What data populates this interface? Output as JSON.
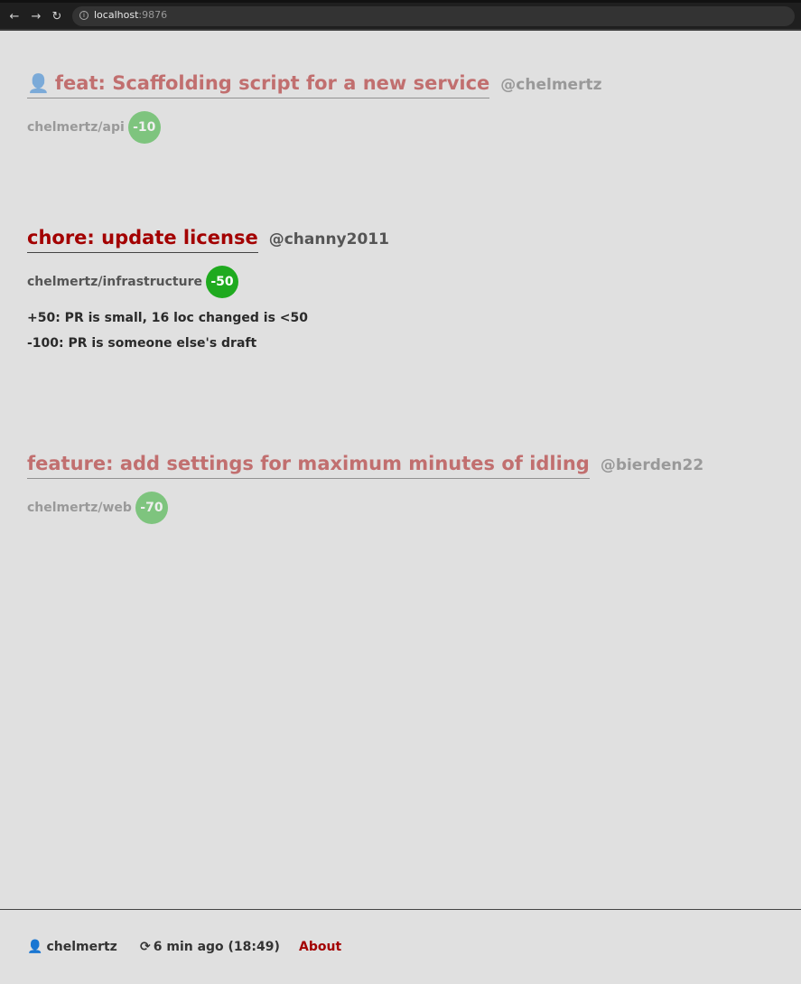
{
  "browser": {
    "url_host": "localhost",
    "url_port": ":9876",
    "back_icon": "arrow-left-icon",
    "forward_icon": "arrow-right-icon",
    "reload_icon": "reload-icon"
  },
  "pulls": [
    {
      "title": "feat: Scaffolding script for a new service",
      "author": "@chelmertz",
      "repo": "chelmertz/api",
      "score": "-10",
      "own": true,
      "faded": true,
      "reasons": []
    },
    {
      "title": "chore: update license",
      "author": "@channy2011",
      "repo": "chelmertz/infrastructure",
      "score": "-50",
      "own": false,
      "faded": false,
      "reasons": [
        "+50: PR is small, 16 loc changed is <50",
        "-100: PR is someone else's draft"
      ]
    },
    {
      "title": "feature: add settings for maximum minutes of idling",
      "author": "@bierden22",
      "repo": "chelmertz/web",
      "score": "-70",
      "own": false,
      "faded": true,
      "reasons": []
    }
  ],
  "footer": {
    "user": "chelmertz",
    "refresh": "6 min ago (18:49)",
    "about": "About"
  },
  "colors": {
    "title": "#a30000",
    "score_badge": "#1faa1f",
    "background": "#e0e0e0"
  }
}
